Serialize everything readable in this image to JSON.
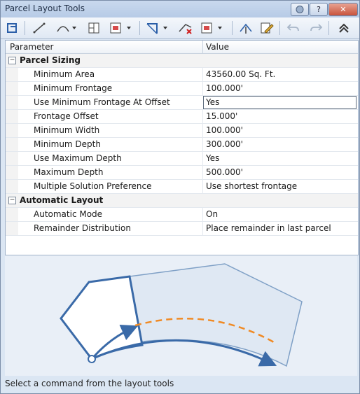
{
  "window": {
    "title": "Parcel Layout Tools"
  },
  "titlebar_buttons": {
    "help": "?",
    "close": "✕"
  },
  "toolbar": {
    "icons": [
      "layout-tools-icon",
      "line-icon",
      "curve-icon",
      "slide-line-icon",
      "swing-line-icon",
      "select-parcel-icon",
      "delete-subentity-icon",
      "parcel-union-icon",
      "pick-subentity-icon",
      "edit-icon",
      "undo-icon",
      "redo-icon",
      "collapse-icon"
    ]
  },
  "grid": {
    "header": {
      "parameter": "Parameter",
      "value": "Value"
    },
    "categories": [
      {
        "label": "Parcel Sizing",
        "expander": "−",
        "rows": [
          {
            "name": "Minimum Area",
            "value": "43560.00 Sq. Ft."
          },
          {
            "name": "Minimum Frontage",
            "value": "100.000'"
          },
          {
            "name": "Use Minimum Frontage At Offset",
            "value": "Yes"
          },
          {
            "name": "Frontage Offset",
            "value": "15.000'"
          },
          {
            "name": "Minimum Width",
            "value": "100.000'"
          },
          {
            "name": "Minimum Depth",
            "value": "300.000'"
          },
          {
            "name": "Use Maximum Depth",
            "value": "Yes"
          },
          {
            "name": "Maximum Depth",
            "value": "500.000'"
          },
          {
            "name": "Multiple Solution Preference",
            "value": "Use shortest frontage"
          }
        ]
      },
      {
        "label": "Automatic Layout",
        "expander": "−",
        "rows": [
          {
            "name": "Automatic Mode",
            "value": "On"
          },
          {
            "name": "Remainder Distribution",
            "value": "Place remainder in last parcel"
          }
        ]
      }
    ]
  },
  "status": {
    "text": "Select a command from the layout tools"
  },
  "colors": {
    "accent": "#3a6aa8",
    "frontage_offset": "#f08a24",
    "parcel_fill": "#dfe8f3"
  }
}
